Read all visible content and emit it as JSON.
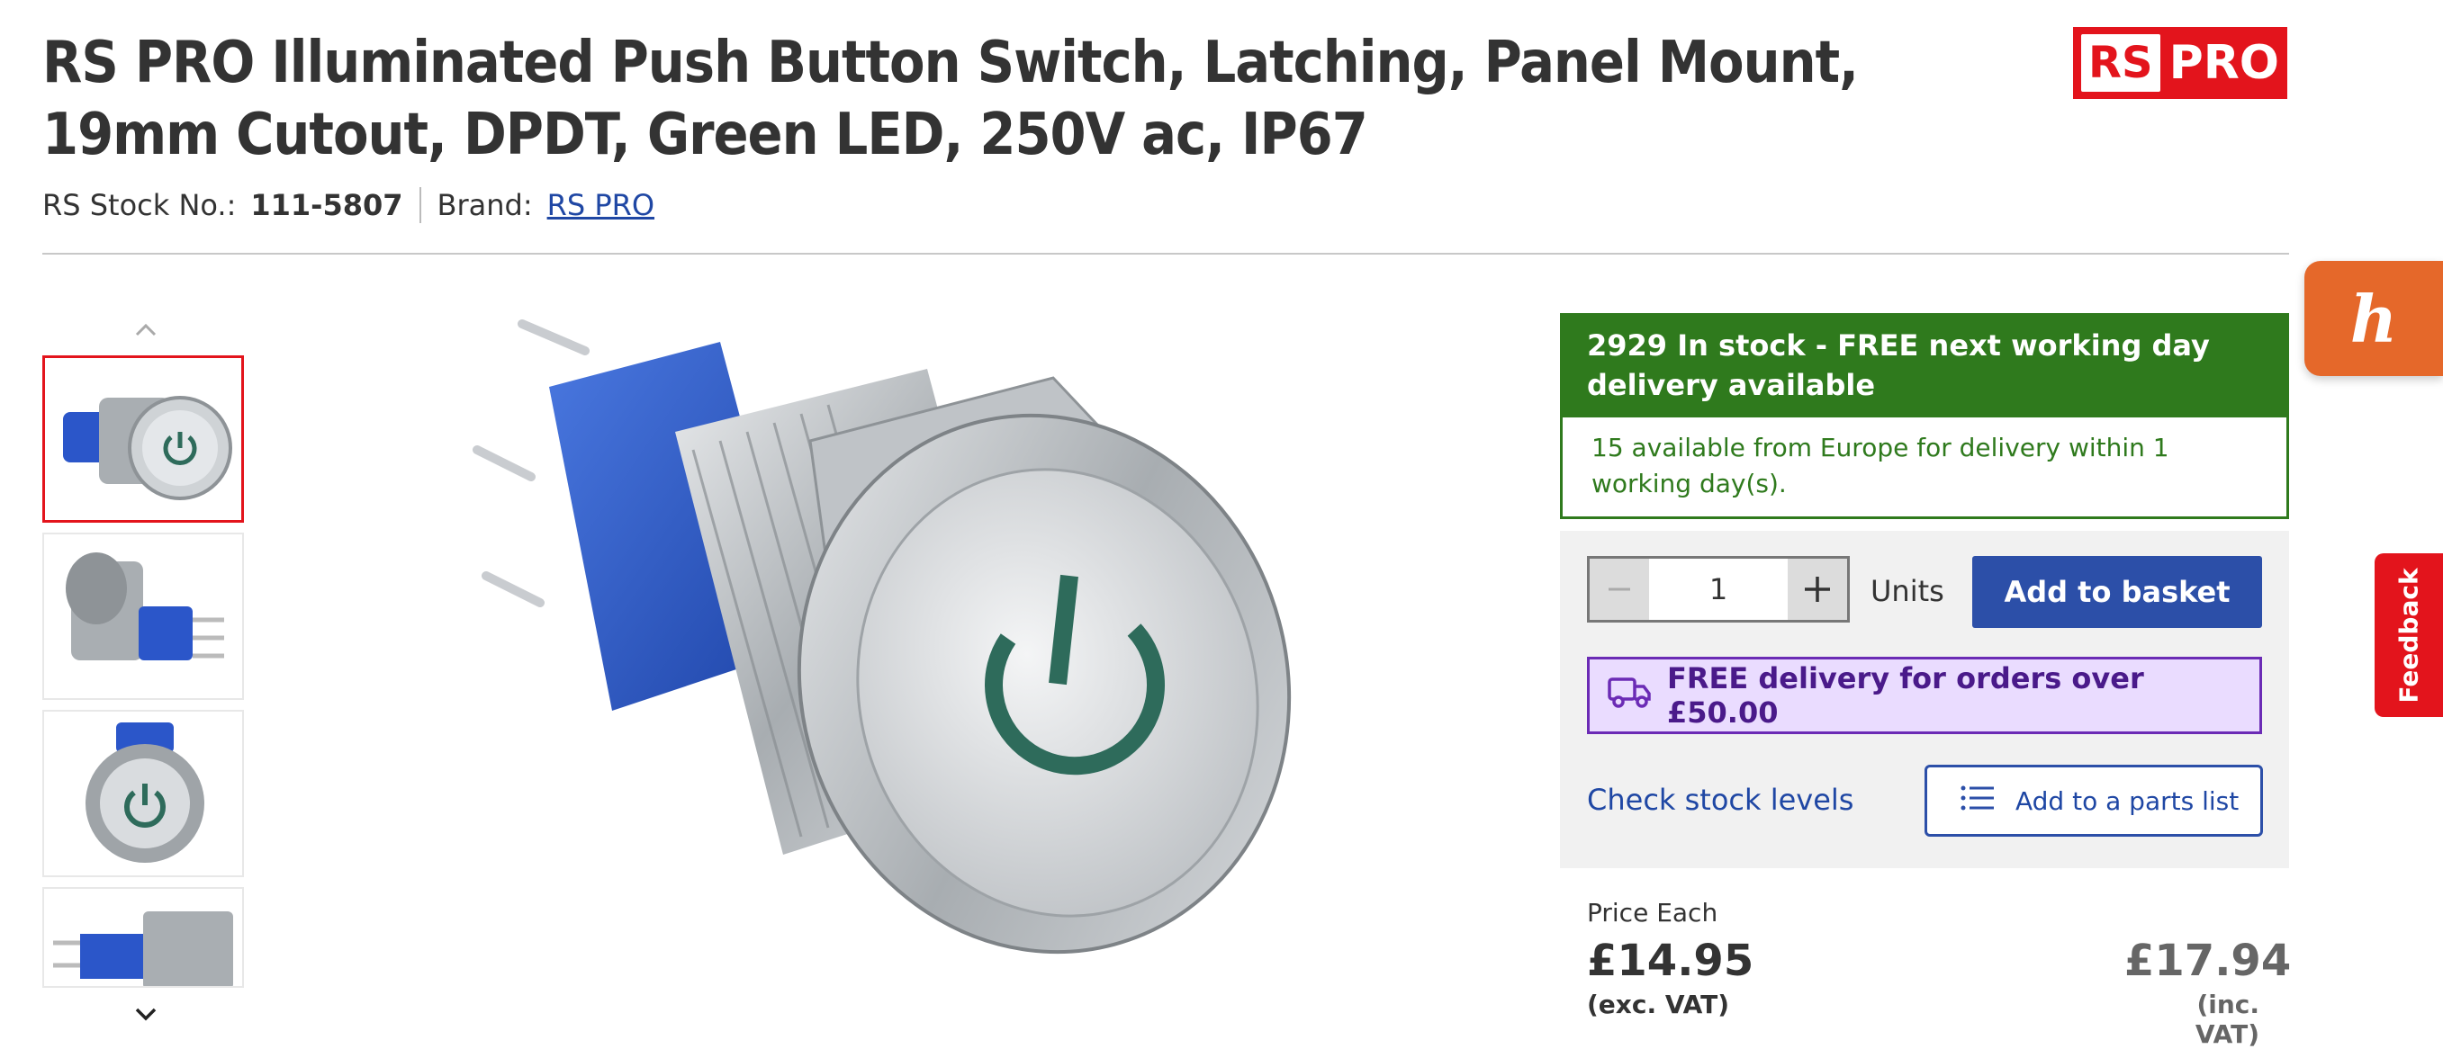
{
  "product": {
    "title": "RS PRO Illuminated Push Button Switch, Latching, Panel Mount, 19mm Cutout, DPDT, Green LED, 250V ac, IP67",
    "stock_label": "RS Stock No.:",
    "stock_no": "111-5807",
    "brand_label": "Brand:",
    "brand": "RS PRO"
  },
  "logo": {
    "rs": "RS",
    "pro": "PRO"
  },
  "gallery": {
    "up_icon": "chevron-up-icon",
    "down_icon": "chevron-down-icon",
    "thumb_count": 4,
    "selected_index": 0
  },
  "availability": {
    "headline": "2929 In stock - FREE next working day delivery available",
    "europe": "15 available from Europe for delivery within 1 working day(s)."
  },
  "purchase": {
    "quantity": "1",
    "units_label": "Units",
    "add_to_basket": "Add to basket",
    "free_delivery": "FREE delivery for orders over £50.00",
    "check_stock": "Check stock levels",
    "add_parts_list": "Add to a parts list"
  },
  "pricing": {
    "label": "Price Each",
    "exc_vat": "£14.95",
    "exc_vat_note": "(exc. VAT)",
    "inc_vat": "£17.94",
    "inc_vat_note": "(inc. VAT)"
  },
  "widgets": {
    "honey_glyph": "h",
    "feedback": "Feedback"
  },
  "colors": {
    "brand_red": "#e3141c",
    "stock_green": "#2f7a1d",
    "primary_blue": "#2c4fa8",
    "delivery_purple": "#6b2bb5",
    "honey_orange": "#e5682a"
  }
}
